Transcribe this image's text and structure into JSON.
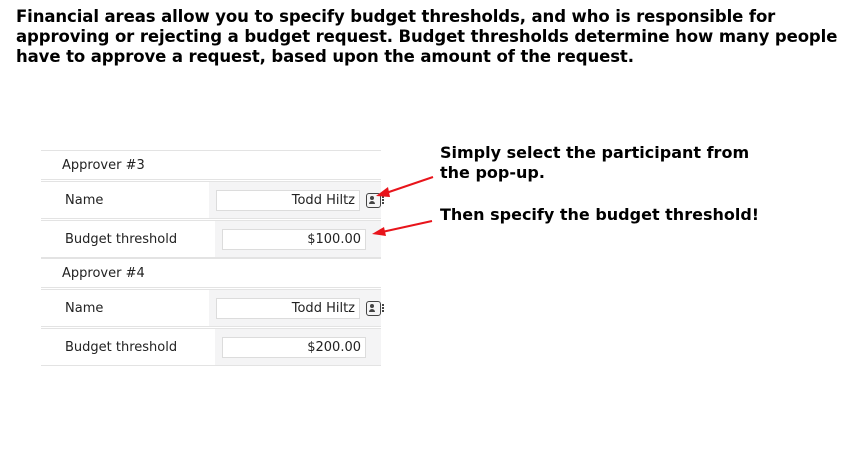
{
  "intro_text": "Financial areas allow you to specify budget thresholds, and who is responsible for approving or rejecting a budget request. Budget thresholds determine how many people have to approve a request, based upon the amount of the request.",
  "approvers": [
    {
      "heading": "Approver #3",
      "name_label": "Name",
      "name_value": "Todd Hiltz",
      "threshold_label": "Budget threshold",
      "threshold_value": "$100.00"
    },
    {
      "heading": "Approver #4",
      "name_label": "Name",
      "name_value": "Todd Hiltz",
      "threshold_label": "Budget threshold",
      "threshold_value": "$200.00"
    }
  ],
  "callouts": {
    "participant": "Simply select the participant from the pop-up.",
    "threshold": "Then specify the budget threshold!"
  },
  "icons": {
    "picker": "contact-card-icon",
    "arrow": "red-arrow-icon"
  },
  "colors": {
    "arrow": "#e8141b",
    "field_bg": "#f4f4f5"
  }
}
